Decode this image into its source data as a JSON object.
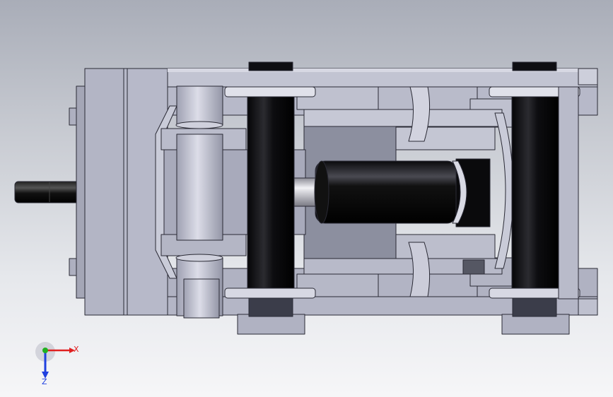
{
  "scene": {
    "view": "top",
    "model": "mechanical-assembly",
    "colors": {
      "background_top": "#a9adb8",
      "background_bottom": "#f6f6f8",
      "metal": "#b9bbcb",
      "metal_light": "#d3d4e0",
      "metal_dark": "#8f92a4",
      "edge": "#2a2a35",
      "roller": "#0b0b0e"
    }
  },
  "triad": {
    "x_label": "X",
    "z_label": "Z",
    "x_color": "#e02020",
    "y_color": "#20b020",
    "z_color": "#2040e0"
  }
}
